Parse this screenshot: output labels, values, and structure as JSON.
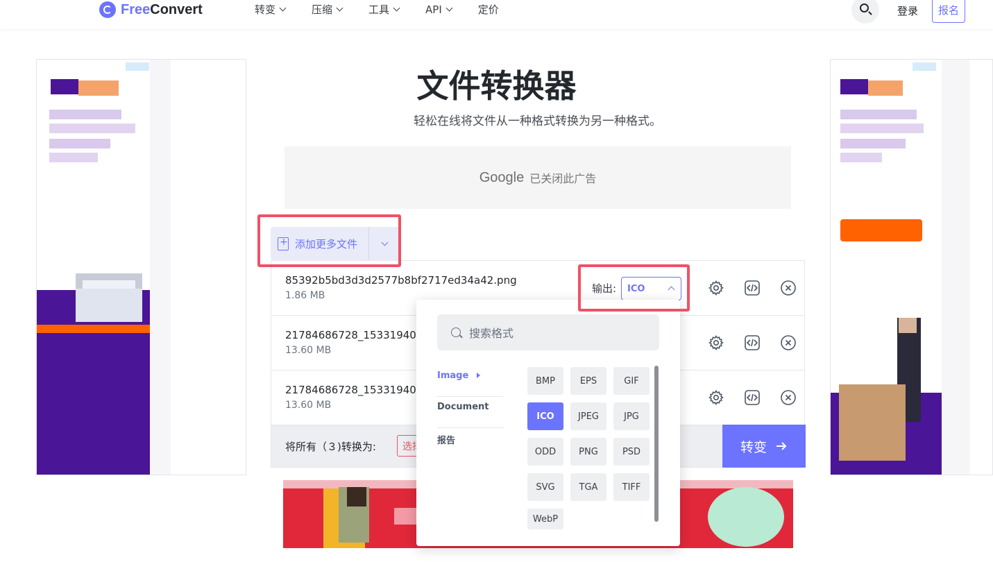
{
  "header": {
    "logo_free": "Free",
    "logo_convert": "Convert",
    "nav": [
      "转变",
      "压缩",
      "工具",
      "API",
      "定价"
    ],
    "login": "登录",
    "signup": "报名"
  },
  "main": {
    "title": "文件转换器",
    "subtitle": "轻松在线将文件从一种格式转换为另一种格式。",
    "ad_notice_brand": "Google",
    "ad_notice_text": "已关闭此广告",
    "add_more_label": "添加更多文件"
  },
  "files": [
    {
      "name": "85392b5bd3d3d2577b8bf2717ed34a42.png",
      "size": "1.86 MB"
    },
    {
      "name": "21784686728_153319406",
      "size": "13.60 MB"
    },
    {
      "name": "21784686728_153319406",
      "size": "13.60 MB"
    }
  ],
  "output": {
    "label": "输出:",
    "selected": "ICO"
  },
  "convert_bar": {
    "all_label": "将所有（３)转换为:",
    "choose_label": "选择",
    "convert_button": "转变"
  },
  "format_dropdown": {
    "search_placeholder": "搜索格式",
    "categories": [
      "Image",
      "Document",
      "报告"
    ],
    "active_category": "Image",
    "formats": [
      "BMP",
      "EPS",
      "GIF",
      "ICO",
      "JPEG",
      "JPG",
      "ODD",
      "PNG",
      "PSD",
      "SVG",
      "TGA",
      "TIFF",
      "WebP"
    ],
    "selected_format": "ICO"
  },
  "colors": {
    "accent": "#6c73ff",
    "highlight": "#ee5266",
    "ad_purple": "#4b1597",
    "ad_orange": "#ff6200"
  }
}
